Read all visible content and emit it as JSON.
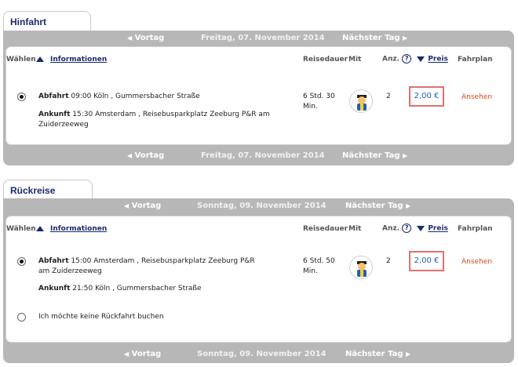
{
  "hinfahrt": {
    "tab_label": "Hinfahrt",
    "nav": {
      "prev": "Vortag",
      "date": "Freitag, 07. November 2014",
      "next": "Nächster Tag"
    },
    "headers": {
      "waehlen": "Wählen",
      "informationen": "Informationen",
      "reisedauer": "Reisedauer",
      "mit": "Mit",
      "anz": "Anz.",
      "preis": "Preis",
      "fahrplan": "Fahrplan"
    },
    "row": {
      "abfahrt_label": "Abfahrt",
      "abfahrt_value": "09:00 Köln , Gummersbacher Straße",
      "ankunft_label": "Ankunft",
      "ankunft_value": "15:30 Amsterdam , Reisebusparkplatz Zeeburg P&R am Zuiderzeeweg",
      "duration": "6 Std. 30 Min.",
      "count": "2",
      "price": "2,00 €",
      "fahrplan_link": "Ansehen"
    }
  },
  "rueckreise": {
    "tab_label": "Rückreise",
    "nav": {
      "prev": "Vortag",
      "date": "Sonntag, 09. November 2014",
      "next": "Nächster Tag"
    },
    "headers": {
      "waehlen": "Wählen",
      "informationen": "Informationen",
      "reisedauer": "Reisedauer",
      "mit": "Mit",
      "anz": "Anz.",
      "preis": "Preis",
      "fahrplan": "Fahrplan"
    },
    "row": {
      "abfahrt_label": "Abfahrt",
      "abfahrt_value": "15:00 Amsterdam , Reisebusparkplatz Zeeburg P&R am Zuiderzeeweg",
      "ankunft_label": "Ankunft",
      "ankunft_value": "21:50 Köln , Gummersbacher Straße",
      "duration": "6 Std. 50 Min.",
      "count": "2",
      "price": "2,00 €",
      "fahrplan_link": "Ansehen"
    },
    "no_return_label": "Ich möchte keine Rückfahrt buchen"
  },
  "colors": {
    "frame_gray": "#b7b7b7",
    "accent_blue": "#1a2a6c",
    "price_highlight": "#e07070",
    "price_text": "#2a5db0",
    "link_orange": "#d04a1a"
  }
}
